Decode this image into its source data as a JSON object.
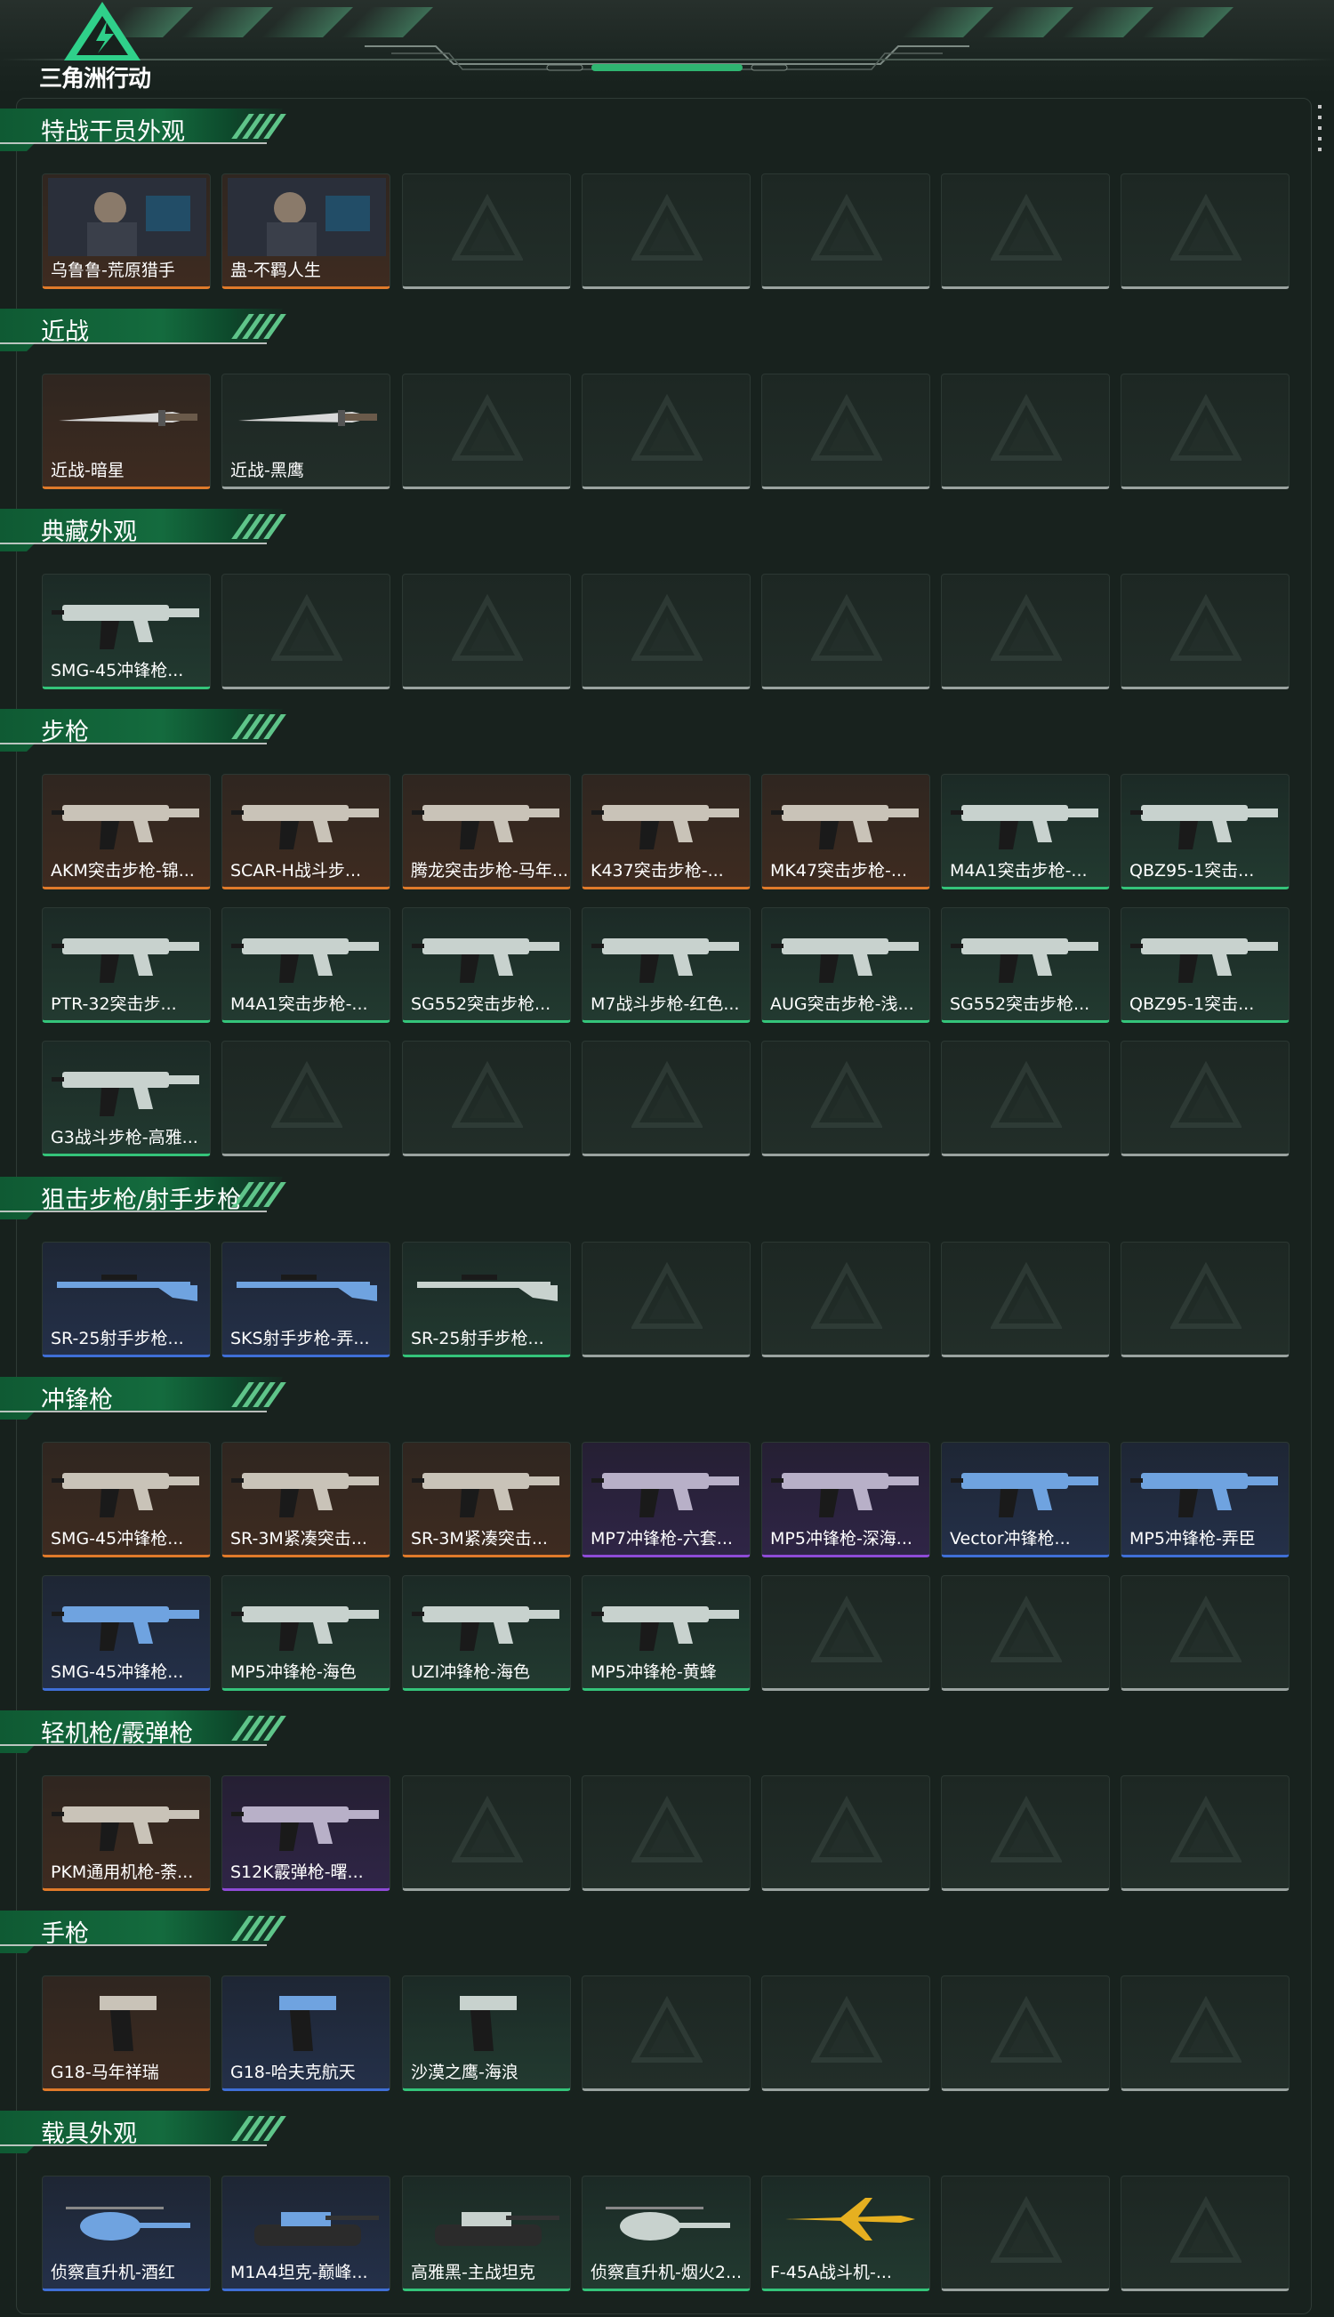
{
  "header": {
    "logo_text": "三角洲行动"
  },
  "colors": {
    "orange": "#e07a2a",
    "purple": "#8e4bd6",
    "blue": "#3f6fd6",
    "green": "#34c47a",
    "empty": "#9aa3a0",
    "section_green": "#146b3e"
  },
  "sections": [
    {
      "title": "特战干员外观",
      "items": [
        {
          "label": "乌鲁鲁-荒原猎手",
          "rarity": "orange",
          "icon": "operator-portrait-icon"
        },
        {
          "label": "蛊-不羁人生",
          "rarity": "orange",
          "icon": "operator-portrait-icon"
        }
      ]
    },
    {
      "title": "近战",
      "items": [
        {
          "label": "近战-暗星",
          "rarity": "orange",
          "icon": "knife-icon"
        },
        {
          "label": "近战-黑鹰",
          "rarity": "empty",
          "icon": "knife-icon"
        }
      ]
    },
    {
      "title": "典藏外观",
      "items": [
        {
          "label": "SMG-45冲锋枪...",
          "rarity": "green",
          "icon": "smg-icon"
        }
      ]
    },
    {
      "title": "步枪",
      "items": [
        {
          "label": "AKM突击步枪-锦...",
          "rarity": "orange",
          "icon": "rifle-icon"
        },
        {
          "label": "SCAR-H战斗步...",
          "rarity": "orange",
          "icon": "rifle-icon"
        },
        {
          "label": "腾龙突击步枪-马年...",
          "rarity": "orange",
          "icon": "rifle-icon"
        },
        {
          "label": "K437突击步枪-...",
          "rarity": "orange",
          "icon": "rifle-icon"
        },
        {
          "label": "MK47突击步枪-...",
          "rarity": "orange",
          "icon": "rifle-icon"
        },
        {
          "label": "M4A1突击步枪-...",
          "rarity": "green",
          "icon": "rifle-icon"
        },
        {
          "label": "QBZ95-1突击...",
          "rarity": "green",
          "icon": "rifle-icon"
        },
        {
          "label": "PTR-32突击步...",
          "rarity": "green",
          "icon": "rifle-icon"
        },
        {
          "label": "M4A1突击步枪-...",
          "rarity": "green",
          "icon": "rifle-icon"
        },
        {
          "label": "SG552突击步枪...",
          "rarity": "green",
          "icon": "rifle-icon"
        },
        {
          "label": "M7战斗步枪-红色...",
          "rarity": "green",
          "icon": "rifle-icon"
        },
        {
          "label": "AUG突击步枪-浅...",
          "rarity": "green",
          "icon": "rifle-icon"
        },
        {
          "label": "SG552突击步枪...",
          "rarity": "green",
          "icon": "rifle-icon"
        },
        {
          "label": "QBZ95-1突击...",
          "rarity": "green",
          "icon": "rifle-icon"
        },
        {
          "label": "G3战斗步枪-高雅...",
          "rarity": "green",
          "icon": "rifle-icon"
        }
      ]
    },
    {
      "title": "狙击步枪/射手步枪",
      "items": [
        {
          "label": "SR-25射手步枪...",
          "rarity": "blue",
          "icon": "sniper-icon"
        },
        {
          "label": "SKS射手步枪-弄...",
          "rarity": "blue",
          "icon": "sniper-icon"
        },
        {
          "label": "SR-25射手步枪...",
          "rarity": "green",
          "icon": "sniper-icon"
        }
      ]
    },
    {
      "title": "冲锋枪",
      "items": [
        {
          "label": "SMG-45冲锋枪...",
          "rarity": "orange",
          "icon": "smg-icon"
        },
        {
          "label": "SR-3M紧凑突击...",
          "rarity": "orange",
          "icon": "smg-icon"
        },
        {
          "label": "SR-3M紧凑突击...",
          "rarity": "orange",
          "icon": "smg-icon"
        },
        {
          "label": "MP7冲锋枪-六套...",
          "rarity": "purple",
          "icon": "smg-icon"
        },
        {
          "label": "MP5冲锋枪-深海...",
          "rarity": "purple",
          "icon": "smg-icon"
        },
        {
          "label": "Vector冲锋枪...",
          "rarity": "blue",
          "icon": "smg-icon"
        },
        {
          "label": "MP5冲锋枪-弄臣",
          "rarity": "blue",
          "icon": "smg-icon"
        },
        {
          "label": "SMG-45冲锋枪...",
          "rarity": "blue",
          "icon": "smg-icon"
        },
        {
          "label": "MP5冲锋枪-海色",
          "rarity": "green",
          "icon": "smg-icon"
        },
        {
          "label": "UZI冲锋枪-海色",
          "rarity": "green",
          "icon": "smg-icon"
        },
        {
          "label": "MP5冲锋枪-黄蜂",
          "rarity": "green",
          "icon": "smg-icon"
        }
      ]
    },
    {
      "title": "轻机枪/霰弹枪",
      "items": [
        {
          "label": "PKM通用机枪-荼...",
          "rarity": "orange",
          "icon": "lmg-icon"
        },
        {
          "label": "S12K霰弹枪-曙...",
          "rarity": "purple",
          "icon": "shotgun-icon"
        }
      ]
    },
    {
      "title": "手枪",
      "items": [
        {
          "label": "G18-马年祥瑞",
          "rarity": "orange",
          "icon": "pistol-icon"
        },
        {
          "label": "G18-哈夫克航天",
          "rarity": "blue",
          "icon": "pistol-icon"
        },
        {
          "label": "沙漠之鹰-海浪",
          "rarity": "green",
          "icon": "pistol-icon"
        }
      ]
    },
    {
      "title": "载具外观",
      "items": [
        {
          "label": "侦察直升机-酒红",
          "rarity": "blue",
          "icon": "helicopter-icon"
        },
        {
          "label": "M1A4坦克-巅峰...",
          "rarity": "blue",
          "icon": "tank-icon"
        },
        {
          "label": "高雅黑-主战坦克",
          "rarity": "green",
          "icon": "tank-icon"
        },
        {
          "label": "侦察直升机-烟火2...",
          "rarity": "green",
          "icon": "helicopter-icon"
        },
        {
          "label": "F-45A战斗机-...",
          "rarity": "green",
          "icon": "jet-icon"
        }
      ]
    }
  ]
}
